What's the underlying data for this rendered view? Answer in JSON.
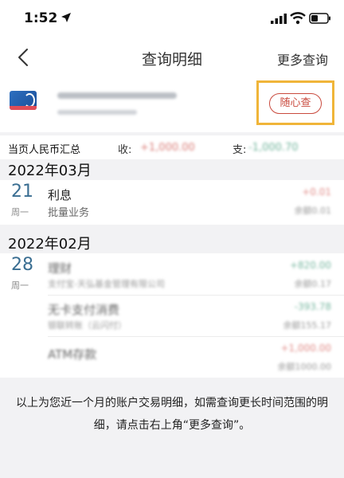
{
  "status_bar": {
    "time": "1:52"
  },
  "nav": {
    "title": "查询明细",
    "more": "更多查询"
  },
  "account": {
    "query_button": "随心查"
  },
  "summary": {
    "label": "当页人民币汇总",
    "income_label": "收:",
    "income_value": "+1,000.00",
    "expense_label": "支:",
    "expense_value": "-1,000.70"
  },
  "months": [
    {
      "title": "2022年03月",
      "days": [
        {
          "day": "21",
          "weekday": "周一",
          "transactions": [
            {
              "title": "利息",
              "subtitle": "批量业务",
              "amount": "+0.01",
              "balance": "余额0.01"
            }
          ]
        }
      ]
    },
    {
      "title": "2022年02月",
      "days": [
        {
          "day": "28",
          "weekday": "周一",
          "transactions": [
            {
              "title": "理财",
              "subtitle": "支付宝-天弘基金管理有限公司",
              "amount": "+820.00",
              "balance": "余额0.17"
            },
            {
              "title": "无卡支付消费",
              "subtitle": "银联转账（云闪付）",
              "amount": "-393.78",
              "balance": "余额155.17"
            },
            {
              "title": "ATM存款",
              "subtitle": "",
              "amount": "+1,000.00",
              "balance": "余额1000.00"
            }
          ]
        }
      ]
    }
  ],
  "footer": {
    "note": "以上为您近一个月的账户交易明细，如需查询更长时间范围的明细，请点击右上角“更多查询”。"
  },
  "colors": {
    "accent": "#c94a3e",
    "highlight": "#f0b539",
    "date": "#3a6e92",
    "income": "#e08a86",
    "expense": "#77b7a0"
  }
}
